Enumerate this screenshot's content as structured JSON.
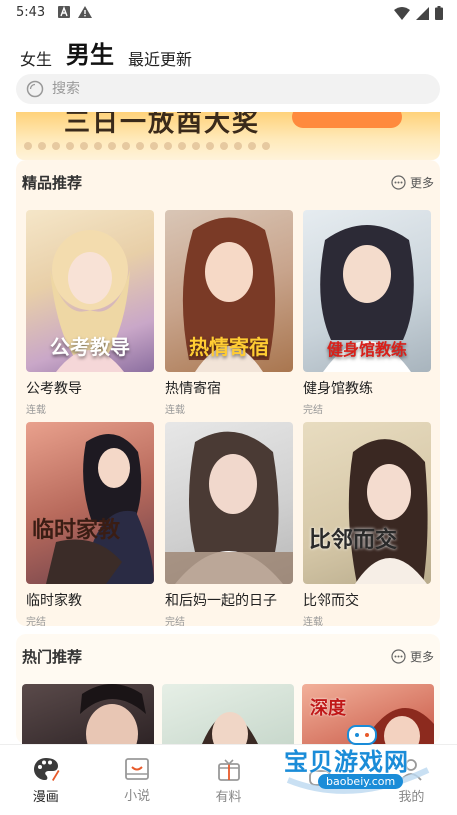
{
  "status_bar": {
    "time": "5:43"
  },
  "top_tabs": [
    {
      "label": "女生",
      "active": false
    },
    {
      "label": "男生",
      "active": true
    },
    {
      "label": "最近更新",
      "active": false
    }
  ],
  "search": {
    "placeholder": "搜索"
  },
  "banner": {
    "text": "三日一放酉大奖"
  },
  "featured": {
    "title": "精品推荐",
    "more_label": "更多",
    "items": [
      {
        "title": "公考教导",
        "status": "连载",
        "cover_text": "公考教导"
      },
      {
        "title": "热情寄宿",
        "status": "连载",
        "cover_text": "热情寄宿"
      },
      {
        "title": "健身馆教练",
        "status": "完结",
        "cover_text": "健身馆教练"
      },
      {
        "title": "临时家教",
        "status": "完结",
        "cover_text": "临时家教"
      },
      {
        "title": "和后妈一起的日子",
        "status": "完结",
        "cover_text": ""
      },
      {
        "title": "比邻而交",
        "status": "连载",
        "cover_text": "比邻而交"
      }
    ]
  },
  "hot": {
    "title": "热门推荐",
    "more_label": "更多",
    "items": [
      {
        "cover_text": ""
      },
      {
        "cover_text": ""
      },
      {
        "cover_text": "深度"
      }
    ]
  },
  "bottom_nav": [
    {
      "label": "漫画",
      "icon": "palette-icon",
      "active": true
    },
    {
      "label": "小说",
      "icon": "book-icon",
      "active": false
    },
    {
      "label": "有料",
      "icon": "gift-icon",
      "active": false
    },
    {
      "label": "",
      "icon": "game-icon",
      "active": false
    },
    {
      "label": "我的",
      "icon": "user-icon",
      "active": false
    }
  ],
  "watermark": {
    "text": "宝贝游戏网",
    "url": "baobeiy.com"
  }
}
